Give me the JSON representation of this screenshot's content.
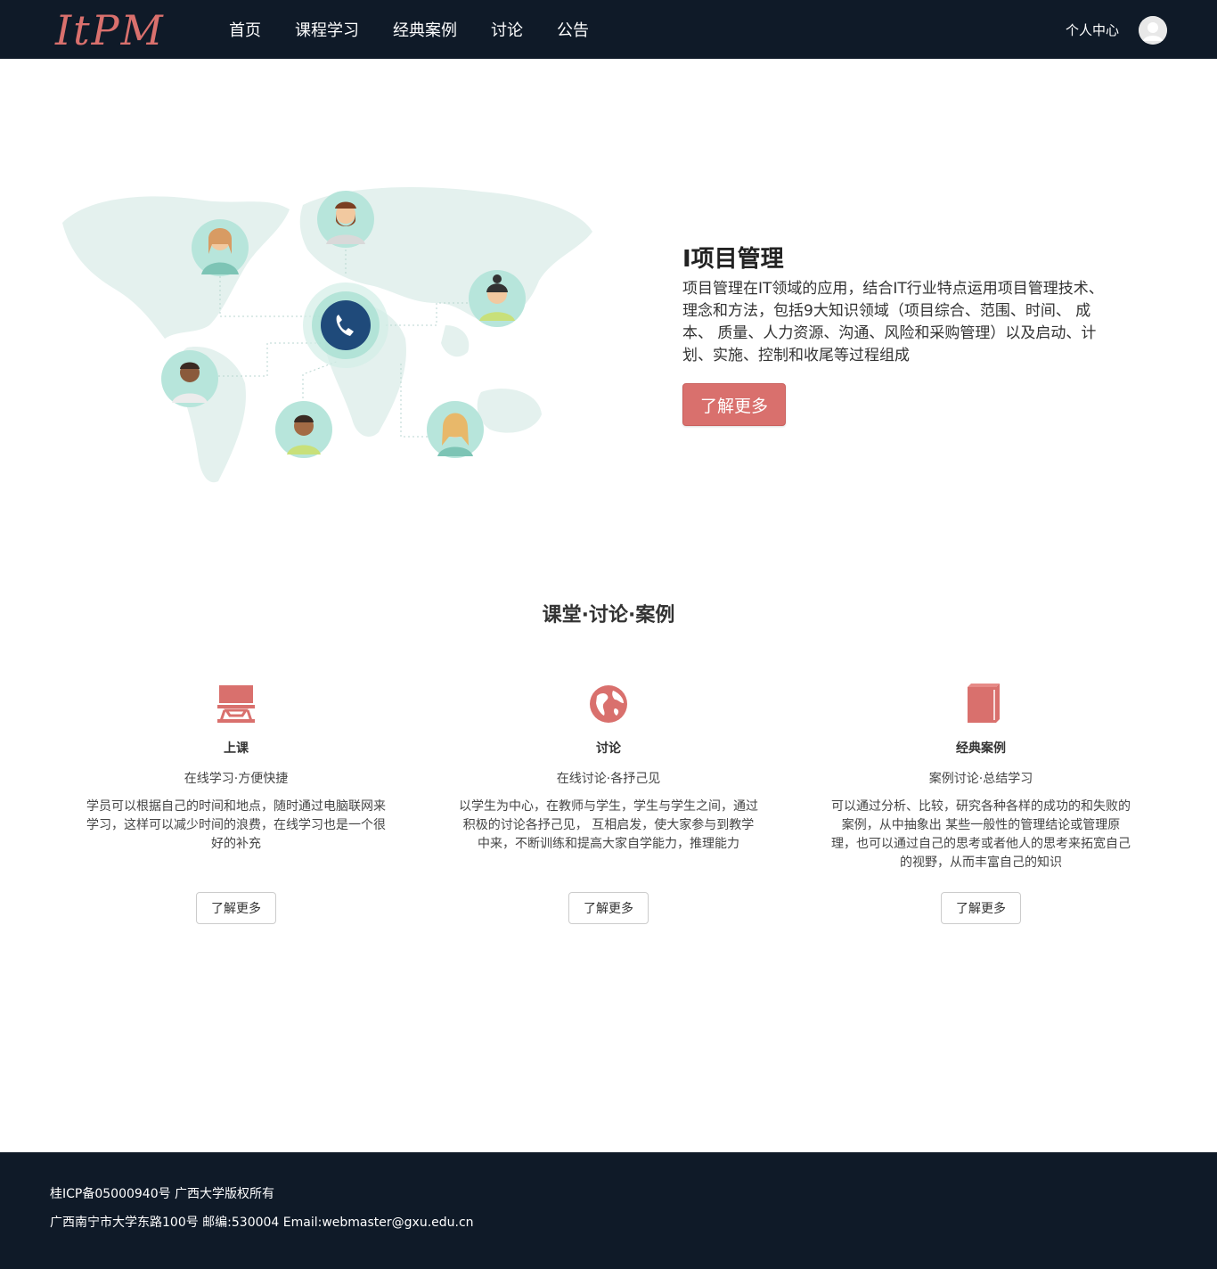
{
  "nav": {
    "logo_text": "ItPM",
    "links": [
      "首页",
      "课程学习",
      "经典案例",
      "讨论",
      "公告"
    ],
    "user_center": "个人中心"
  },
  "hero": {
    "title": "I项目管理",
    "description": "项目管理在IT领域的应用，结合IT行业特点运用项目管理技术、理念和方法，包括9大知识领域（项目综合、范围、时间、 成本、 质量、人力资源、沟通、风险和采购管理）以及启动、计划、实施、控制和收尾等过程组成",
    "button": "了解更多"
  },
  "section": {
    "title": "课堂·讨论·案例"
  },
  "features": [
    {
      "icon": "monitor-icon",
      "title": "上课",
      "subtitle": "在线学习·方便快捷",
      "description": "学员可以根据自己的时间和地点，随时通过电脑联网来学习，这样可以减少时间的浪费，在线学习也是一个很好的补充",
      "button": "了解更多"
    },
    {
      "icon": "globe-icon",
      "title": "讨论",
      "subtitle": "在线讨论·各抒己见",
      "description": "以学生为中心，在教师与学生，学生与学生之间，通过积极的讨论各抒己见， 互相启发，使大家参与到教学中来，不断训练和提高大家自学能力，推理能力",
      "button": "了解更多"
    },
    {
      "icon": "book-icon",
      "title": "经典案例",
      "subtitle": "案例讨论·总结学习",
      "description": "可以通过分析、比较，研究各种各样的成功的和失败的案例，从中抽象出 某些一般性的管理结论或管理原理，也可以通过自己的思考或者他人的思考来拓宽自己的视野，从而丰富自己的知识",
      "button": "了解更多"
    }
  ],
  "footer": {
    "line1": "桂ICP备05000940号 广西大学版权所有",
    "line2": "广西南宁市大学东路100号 邮编:530004 Email:webmaster@gxu.edu.cn"
  },
  "colors": {
    "nav_bg": "#0f1a28",
    "accent": "#d9706d",
    "logo": "#d9706d",
    "map": "#e4f1ee",
    "phone_circle": "#1f4a7a"
  }
}
